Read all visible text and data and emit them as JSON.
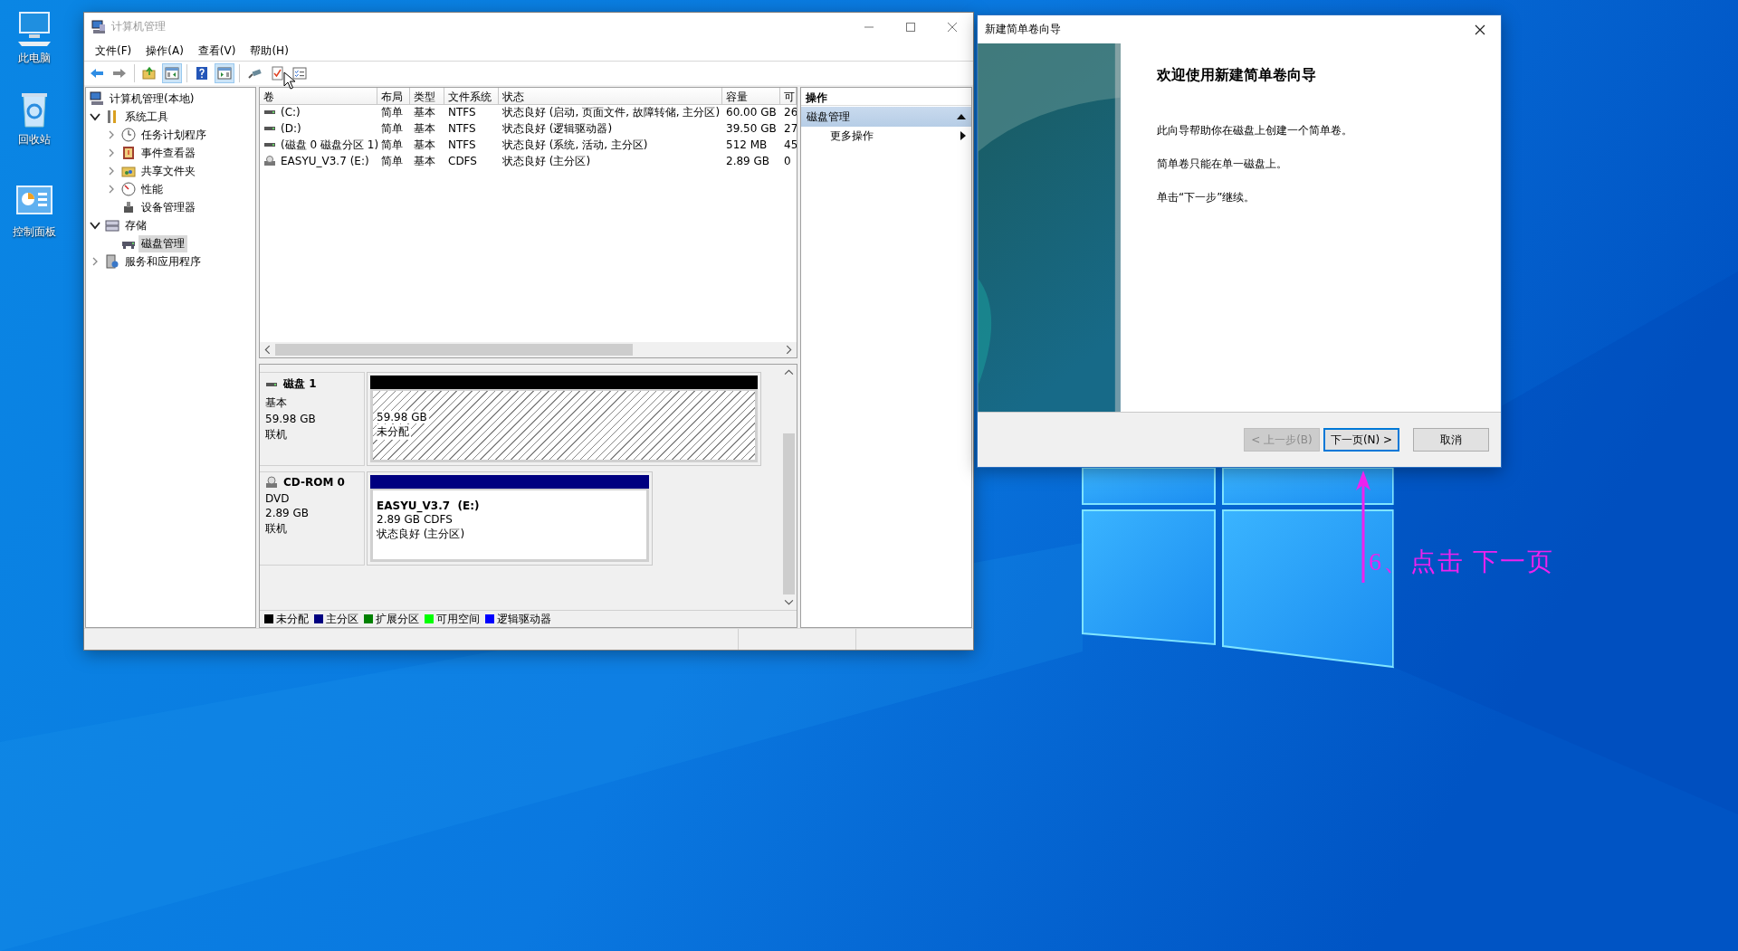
{
  "desktop_icons": [
    {
      "kind": "computer",
      "label": "此电脑"
    },
    {
      "kind": "recycle",
      "label": "回收站"
    },
    {
      "kind": "control",
      "label": "控制面板"
    }
  ],
  "main_window": {
    "title": "计算机管理",
    "menu": [
      "文件(F)",
      "操作(A)",
      "查看(V)",
      "帮助(H)"
    ],
    "toolbar": [
      {
        "pressed": false
      },
      {
        "pressed": false
      },
      {
        "pressed": false
      },
      {
        "pressed": true
      },
      {
        "pressed": false
      },
      {
        "pressed": true
      },
      {
        "pressed": false
      },
      {
        "pressed": false
      },
      {
        "pressed": false
      }
    ],
    "tree": [
      {
        "label": "计算机管理(本地)",
        "kind": "computer",
        "selected": false,
        "children": [
          {
            "label": "系统工具",
            "kind": "tools",
            "expanded": true,
            "selected": false,
            "children": [
              {
                "label": "任务计划程序",
                "kind": "clock",
                "expanded": false,
                "selected": false
              },
              {
                "label": "事件查看器",
                "kind": "log",
                "expanded": false,
                "selected": false
              },
              {
                "label": "共享文件夹",
                "kind": "share",
                "expanded": false,
                "selected": false
              },
              {
                "label": "性能",
                "kind": "perf",
                "expanded": false,
                "selected": false
              },
              {
                "label": "设备管理器",
                "kind": "device",
                "selected": false
              }
            ]
          },
          {
            "label": "存储",
            "kind": "storage",
            "expanded": true,
            "selected": false,
            "children": [
              {
                "label": "磁盘管理",
                "kind": "disk",
                "selected": true
              }
            ]
          },
          {
            "label": "服务和应用程序",
            "kind": "services",
            "expanded": false,
            "selected": false
          }
        ]
      }
    ],
    "volumes": {
      "columns": [
        "卷",
        "布局",
        "类型",
        "文件系统",
        "状态",
        "容量",
        "可"
      ],
      "rows": [
        {
          "kind": "drive",
          "cells": [
            "(C:)",
            "简单",
            "基本",
            "NTFS",
            "状态良好 (启动, 页面文件, 故障转储, 主分区)",
            "60.00 GB",
            "26"
          ]
        },
        {
          "kind": "drive",
          "cells": [
            "(D:)",
            "简单",
            "基本",
            "NTFS",
            "状态良好 (逻辑驱动器)",
            "39.50 GB",
            "27"
          ]
        },
        {
          "kind": "drive",
          "cells": [
            "(磁盘 0 磁盘分区 1)",
            "简单",
            "基本",
            "NTFS",
            "状态良好 (系统, 活动, 主分区)",
            "512 MB",
            "45"
          ]
        },
        {
          "kind": "disc",
          "cells": [
            "EASYU_V3.7 (E:)",
            "简单",
            "基本",
            "CDFS",
            "状态良好 (主分区)",
            "2.89 GB",
            "0"
          ]
        }
      ]
    },
    "disks": [
      {
        "kind": "disk",
        "name": "磁盘 1",
        "lines": [
          "基本",
          "59.98 GB",
          "联机"
        ],
        "partitions": [
          {
            "kind": "unallocated",
            "lines": [
              "59.98 GB",
              "未分配"
            ]
          }
        ]
      },
      {
        "kind": "cdrom",
        "name": "CD-ROM 0",
        "lines": [
          "DVD",
          "2.89 GB",
          "联机"
        ],
        "partitions": [
          {
            "kind": "primary",
            "title": "EASYU_V3.7  (E:)",
            "lines": [
              "2.89 GB CDFS",
              "状态良好 (主分区)"
            ]
          }
        ]
      }
    ],
    "legend": [
      {
        "label": "未分配",
        "color": "#000000"
      },
      {
        "label": "主分区",
        "color": "#000080"
      },
      {
        "label": "扩展分区",
        "color": "#008000"
      },
      {
        "label": "可用空间",
        "color": "#00ff00"
      },
      {
        "label": "逻辑驱动器",
        "color": "#0000ff"
      }
    ],
    "actions": {
      "header": "操作",
      "section": {
        "label": "磁盘管理",
        "expanded": true
      },
      "items": [
        {
          "label": "更多操作"
        }
      ]
    }
  },
  "wizard": {
    "title": "新建简单卷向导",
    "heading": "欢迎使用新建简单卷向导",
    "paragraphs": [
      "此向导帮助你在磁盘上创建一个简单卷。",
      "简单卷只能在单一磁盘上。",
      "单击“下一步”继续。"
    ],
    "buttons": [
      {
        "label": "< 上一步(B)",
        "disabled": true,
        "default": false
      },
      {
        "label": "下一页(N) >",
        "disabled": false,
        "default": true
      },
      {
        "label": "取消",
        "disabled": false,
        "default": false
      }
    ]
  },
  "annotation": {
    "text": "6、点击 下一页"
  }
}
